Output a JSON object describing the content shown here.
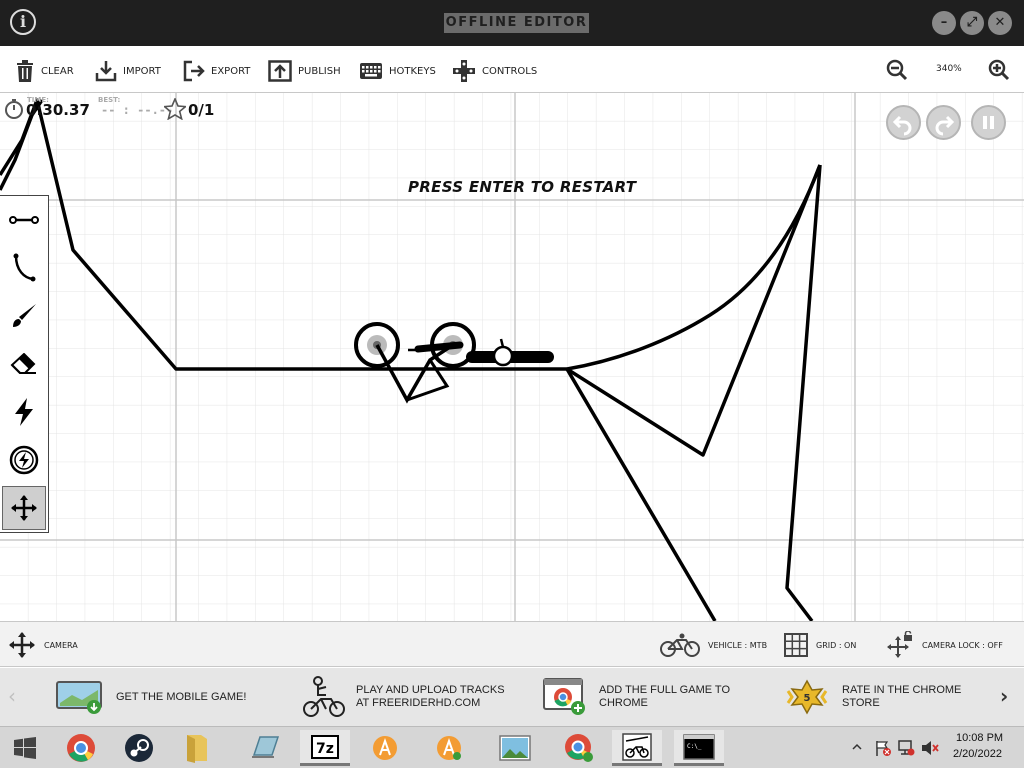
{
  "window": {
    "title": "OFFLINE EDITOR",
    "info_icon": "info-icon",
    "buttons": [
      "minimize-button",
      "maximize-button",
      "close-button"
    ]
  },
  "toolbar": {
    "clear": "CLEAR",
    "import": "IMPORT",
    "export": "EXPORT",
    "publish": "PUBLISH",
    "hotkeys": "HOTKEYS",
    "controls": "CONTROLS",
    "zoom_level": "340%"
  },
  "hud": {
    "time_label": "TIME:",
    "time": "0:30.37",
    "best_label": "BEST:",
    "best": "-- : --.--",
    "stars": "0/1"
  },
  "message": "PRESS ENTER TO RESTART",
  "playback_buttons": [
    "undo-icon",
    "redo-icon",
    "pause-icon"
  ],
  "tools": [
    "straight-line-icon",
    "curve-icon",
    "brush-icon",
    "eraser-icon",
    "boost-icon",
    "power-up-icon",
    "camera-move-icon"
  ],
  "status_bar": {
    "camera": "CAMERA",
    "vehicle": "VEHICLE : MTB",
    "grid": "GRID : ON",
    "camera_lock": "CAMERA LOCK : OFF"
  },
  "promos": [
    {
      "text": "GET THE MOBILE GAME!"
    },
    {
      "text": "PLAY AND UPLOAD TRACKS AT FREERIDERHD.COM"
    },
    {
      "text": "ADD THE FULL GAME TO CHROME"
    },
    {
      "text": "RATE IN THE CHROME STORE",
      "badge": "5"
    }
  ],
  "taskbar": {
    "apps": [
      "windows-start",
      "chrome",
      "steam",
      "file-explorer",
      "app-tablet",
      "7-zip",
      "app-a",
      "app-a-2",
      "photos",
      "chrome-profile",
      "free-rider",
      "command-prompt"
    ],
    "clock_time": "10:08 PM",
    "clock_date": "2/20/2022"
  },
  "colors": {
    "titlebar": "#1f1f1f",
    "grid": "#dcdcdc",
    "track": "#000000"
  }
}
